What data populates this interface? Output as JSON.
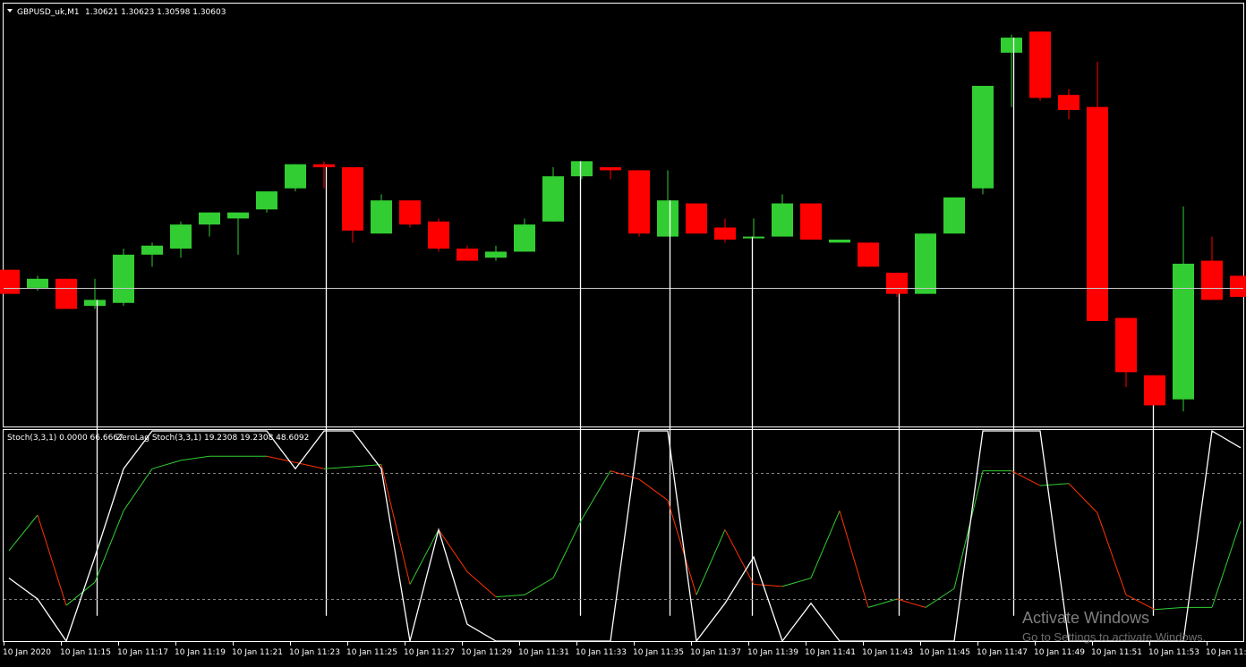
{
  "main_header": {
    "symbol_label": "GBPUSD_uk,M1",
    "ohlc_label": "1.30621 1.30623 1.30598 1.30603",
    "menu_icon": "triangle-down-icon"
  },
  "indicator_header": {
    "stoch_label": "Stoch(3,3,1) 0.0000 66.6667",
    "zerolag_label": "ZeroLag Stoch(3,3,1) 19.2308 19.2308 48.6092"
  },
  "watermark": {
    "line1": "Activate Windows",
    "line2": "Go to Settings to activate Windows."
  },
  "colors": {
    "background": "#000000",
    "bull": "#32cd32",
    "bear": "#ff0000",
    "wick_bull": "#32cd32",
    "wick_bear": "#ff0000",
    "stoch_main": "#ffffff",
    "zerolag_up": "#32cd32",
    "zerolag_down": "#ff3300",
    "grid_level": "#808080",
    "frame": "#ffffff"
  },
  "chart_data": [
    {
      "type": "candlestick",
      "symbol": "GBPUSD_uk",
      "timeframe": "M1",
      "last_ohlc": [
        1.30621,
        1.30623,
        1.30598,
        1.30603
      ],
      "price_range": [
        1.30577,
        1.30717
      ],
      "horizontal_line_price": 1.30623,
      "candles": [
        {
          "o": 1.30629,
          "h": 1.30629,
          "l": 1.30621,
          "c": 1.30621
        },
        {
          "o": 1.30623,
          "h": 1.30627,
          "l": 1.30622,
          "c": 1.30626
        },
        {
          "o": 1.30626,
          "h": 1.30626,
          "l": 1.30616,
          "c": 1.30616
        },
        {
          "o": 1.30617,
          "h": 1.30626,
          "l": 1.30616,
          "c": 1.30619
        },
        {
          "o": 1.30618,
          "h": 1.30636,
          "l": 1.30617,
          "c": 1.30634
        },
        {
          "o": 1.30634,
          "h": 1.30638,
          "l": 1.3063,
          "c": 1.30637
        },
        {
          "o": 1.30636,
          "h": 1.30645,
          "l": 1.30633,
          "c": 1.30644
        },
        {
          "o": 1.30644,
          "h": 1.30648,
          "l": 1.3064,
          "c": 1.30648
        },
        {
          "o": 1.30646,
          "h": 1.30648,
          "l": 1.30634,
          "c": 1.30648
        },
        {
          "o": 1.30649,
          "h": 1.30655,
          "l": 1.30648,
          "c": 1.30655
        },
        {
          "o": 1.30656,
          "h": 1.30664,
          "l": 1.30655,
          "c": 1.30664
        },
        {
          "o": 1.30664,
          "h": 1.30665,
          "l": 1.30656,
          "c": 1.30663
        },
        {
          "o": 1.30663,
          "h": 1.30663,
          "l": 1.30638,
          "c": 1.30642
        },
        {
          "o": 1.30641,
          "h": 1.30654,
          "l": 1.30641,
          "c": 1.30652
        },
        {
          "o": 1.30652,
          "h": 1.30652,
          "l": 1.30643,
          "c": 1.30644
        },
        {
          "o": 1.30645,
          "h": 1.30646,
          "l": 1.30635,
          "c": 1.30636
        },
        {
          "o": 1.30636,
          "h": 1.30637,
          "l": 1.30632,
          "c": 1.30632
        },
        {
          "o": 1.30633,
          "h": 1.30637,
          "l": 1.30632,
          "c": 1.30635
        },
        {
          "o": 1.30635,
          "h": 1.30646,
          "l": 1.30635,
          "c": 1.30644
        },
        {
          "o": 1.30645,
          "h": 1.30663,
          "l": 1.30645,
          "c": 1.3066
        },
        {
          "o": 1.3066,
          "h": 1.30665,
          "l": 1.30659,
          "c": 1.30665
        },
        {
          "o": 1.30663,
          "h": 1.30663,
          "l": 1.30659,
          "c": 1.30662
        },
        {
          "o": 1.30662,
          "h": 1.30662,
          "l": 1.3064,
          "c": 1.30641
        },
        {
          "o": 1.3064,
          "h": 1.30662,
          "l": 1.3064,
          "c": 1.30652
        },
        {
          "o": 1.30651,
          "h": 1.30651,
          "l": 1.30641,
          "c": 1.30641
        },
        {
          "o": 1.30643,
          "h": 1.30646,
          "l": 1.30638,
          "c": 1.30639
        },
        {
          "o": 1.3064,
          "h": 1.30646,
          "l": 1.3064,
          "c": 1.3064
        },
        {
          "o": 1.3064,
          "h": 1.30654,
          "l": 1.3064,
          "c": 1.30651
        },
        {
          "o": 1.30651,
          "h": 1.30651,
          "l": 1.30639,
          "c": 1.30639
        },
        {
          "o": 1.30638,
          "h": 1.30639,
          "l": 1.30638,
          "c": 1.30639
        },
        {
          "o": 1.30638,
          "h": 1.30638,
          "l": 1.3063,
          "c": 1.3063
        },
        {
          "o": 1.30628,
          "h": 1.30628,
          "l": 1.3062,
          "c": 1.30621
        },
        {
          "o": 1.30621,
          "h": 1.30641,
          "l": 1.30621,
          "c": 1.30641
        },
        {
          "o": 1.30641,
          "h": 1.30653,
          "l": 1.30641,
          "c": 1.30653
        },
        {
          "o": 1.30656,
          "h": 1.3069,
          "l": 1.30654,
          "c": 1.3069
        },
        {
          "o": 1.30701,
          "h": 1.30707,
          "l": 1.30683,
          "c": 1.30706
        },
        {
          "o": 1.30708,
          "h": 1.30708,
          "l": 1.30685,
          "c": 1.30686
        },
        {
          "o": 1.30687,
          "h": 1.30689,
          "l": 1.30679,
          "c": 1.30682
        },
        {
          "o": 1.30683,
          "h": 1.30698,
          "l": 1.30612,
          "c": 1.30612
        },
        {
          "o": 1.30613,
          "h": 1.30613,
          "l": 1.3059,
          "c": 1.30595
        },
        {
          "o": 1.30594,
          "h": 1.30594,
          "l": 1.30584,
          "c": 1.30584
        },
        {
          "o": 1.30586,
          "h": 1.3065,
          "l": 1.30582,
          "c": 1.30631
        },
        {
          "o": 1.30632,
          "h": 1.3064,
          "l": 1.3062,
          "c": 1.30619
        },
        {
          "o": 1.30627,
          "h": 1.30627,
          "l": 1.3062,
          "c": 1.3062
        }
      ],
      "x_tick_labels": [
        "10 Jan 2020",
        "10 Jan 11:15",
        "10 Jan 11:17",
        "10 Jan 11:19",
        "10 Jan 11:21",
        "10 Jan 11:23",
        "10 Jan 11:25",
        "10 Jan 11:27",
        "10 Jan 11:29",
        "10 Jan 11:31",
        "10 Jan 11:33",
        "10 Jan 11:35",
        "10 Jan 11:37",
        "10 Jan 11:39",
        "10 Jan 11:41",
        "10 Jan 11:43",
        "10 Jan 11:45",
        "10 Jan 11:47",
        "10 Jan 11:49",
        "10 Jan 11:51",
        "10 Jan 11:53",
        "10 Jan 11:5"
      ],
      "signal_line_candle_indices": [
        3,
        11,
        20,
        23,
        26,
        31,
        35,
        40
      ]
    },
    {
      "type": "line",
      "indicators": [
        "Stoch(3,3,1)",
        "ZeroLag Stoch(3,3,1)"
      ],
      "ylim": [
        0,
        100
      ],
      "levels": [
        20,
        80
      ],
      "stoch_values": [
        30,
        20,
        0,
        40,
        82,
        100,
        100,
        100,
        100,
        100,
        82,
        100,
        100,
        82,
        0,
        53,
        8,
        0,
        0,
        0,
        0,
        0,
        100,
        100,
        0,
        18,
        40,
        0,
        18,
        0,
        0,
        0,
        0,
        0,
        100,
        100,
        100,
        0,
        0,
        0,
        0,
        0,
        100,
        92
      ],
      "zerolag_values": [
        43,
        60,
        17,
        28,
        62,
        82,
        86,
        88,
        88,
        88,
        85,
        82,
        83,
        84,
        27,
        53,
        33,
        21,
        22,
        30,
        58,
        81,
        77,
        67,
        22,
        53,
        27,
        26,
        30,
        62,
        16,
        20,
        16,
        25,
        81,
        81,
        74,
        75,
        61,
        22,
        15,
        16,
        16,
        57
      ]
    }
  ]
}
